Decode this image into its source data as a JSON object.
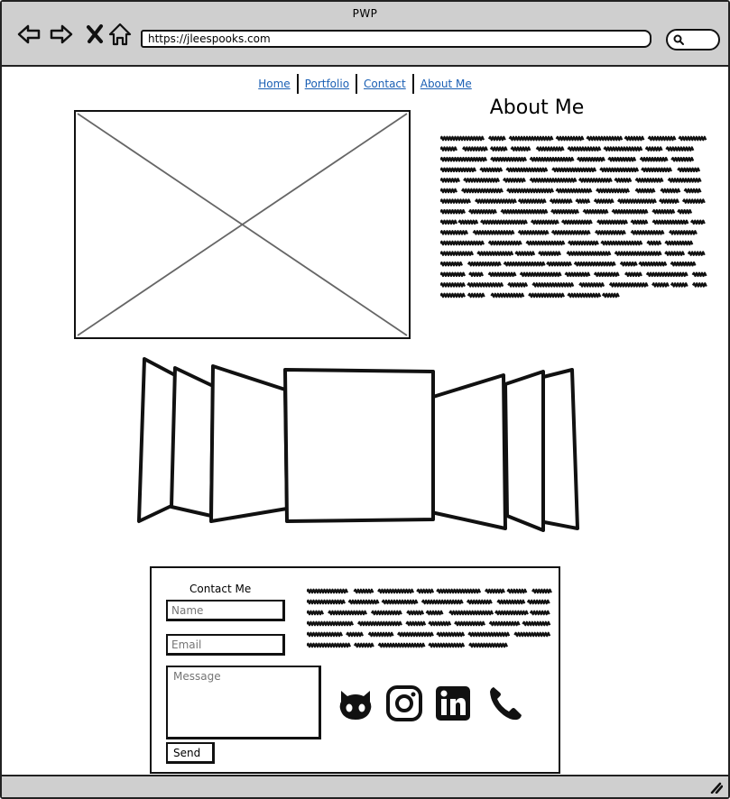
{
  "window": {
    "title": "PWP",
    "url": "https://jleespooks.com"
  },
  "icons": {
    "back": "back-arrow-icon",
    "forward": "forward-arrow-icon",
    "close": "close-icon",
    "home": "home-icon",
    "search": "search-icon",
    "github": "github-icon",
    "instagram": "instagram-icon",
    "linkedin": "linkedin-icon",
    "phone": "phone-icon",
    "resize": "resize-grip-icon"
  },
  "nav": {
    "items": [
      {
        "label": "Home"
      },
      {
        "label": "Portfolio"
      },
      {
        "label": "Contact"
      },
      {
        "label": "About Me"
      }
    ]
  },
  "about": {
    "title": "About Me"
  },
  "contact": {
    "title": "Contact Me",
    "name_placeholder": "Name",
    "email_placeholder": "Email",
    "message_placeholder": "Message",
    "send_label": "Send"
  },
  "colors": {
    "chrome": "#cfcfcf",
    "link": "#1a5fb4",
    "ink": "#111111"
  }
}
